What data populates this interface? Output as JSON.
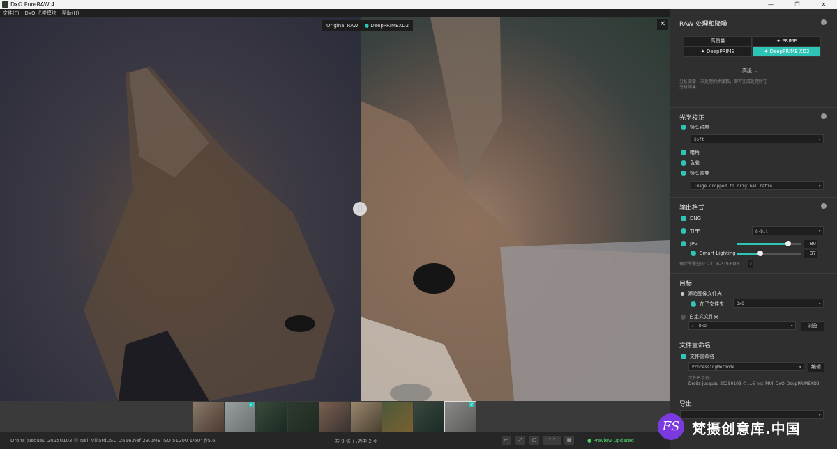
{
  "app": {
    "title": "DxO PureRAW 4",
    "window_controls": [
      "—",
      "❐",
      "✕"
    ]
  },
  "menu": [
    "文件(F)",
    "DxO 光学模块",
    "帮助(H)"
  ],
  "viewer": {
    "label_left": "Original RAW",
    "label_right": "DeepPRIMEXD2",
    "handle": "||",
    "close": "✕"
  },
  "panel": {
    "raw": {
      "title": "RAW 处理和降噪",
      "buttons": [
        "高质量",
        "PRIME",
        "DeepPRIME",
        "DeepPRIME XD2"
      ],
      "active": "DeepPRIME XD2",
      "advanced": "高级",
      "note": "分析需要一次处理的步骤数，即可完成处理所在分析结果"
    },
    "optics": {
      "title": "光学校正",
      "lens_sharpness": "镜头锐度",
      "sharpness_value": "Soft",
      "vignetting": "暗角",
      "chromatic": "色差",
      "distortion": "镜头畸变",
      "distortion_value": "Image cropped to original ratio"
    },
    "output": {
      "title": "输出格式",
      "dng": "DNG",
      "tiff": "TIFF",
      "tiff_value": "8-bit",
      "jpg": "JPG",
      "jpg_quality": "80",
      "jpg_quality_frac": 0.8,
      "smart_lighting": "Smart Lighting",
      "smart_value": "37",
      "smart_frac": 0.37,
      "size_note": "预计所需空间: 231.6-319.6MB",
      "help": "?"
    },
    "destination": {
      "title": "目标",
      "original_folder": "源始图像文件夹",
      "subfolder": "在子文件夹",
      "subfolder_value": "DxO",
      "custom_folder": "自定义文件夹",
      "custom_value": "DxO",
      "browse": "浏览"
    },
    "rename": {
      "title": "文件重命名",
      "rename_label": "文件重命名",
      "pattern": "ProcessingMethode",
      "edit": "编辑",
      "example_label": "文件名示例:",
      "example": "Droits jusquau 20250103 © ...6-net_PR4_DxO_DeepPRIMEXD2"
    },
    "export": {
      "title": "导出"
    }
  },
  "status": {
    "meta": "Droits jusquau 20250103 © Neil VillardDSC_2656.nef    29.0MB    ISO 51200    1/60\"    ƒ/5.6",
    "count": "共 9 张 已选中 2 张",
    "zoom": "1:1",
    "preview": "● Preview updated"
  },
  "watermark": {
    "logo": "FS",
    "text": "梵摄创意库.中国"
  },
  "colors": {
    "accent": "#2ec4b6",
    "preview_green": "#4bd36b"
  }
}
